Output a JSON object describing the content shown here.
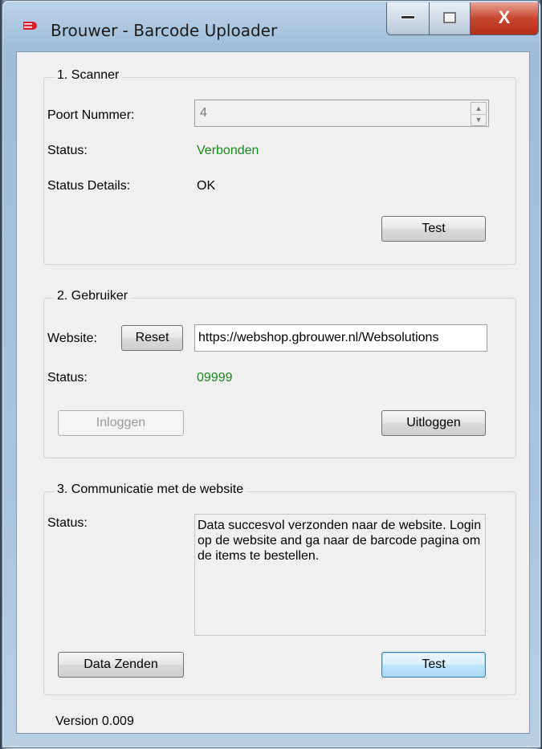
{
  "window": {
    "title": "Brouwer - Barcode Uploader",
    "app_icon": "brouwer-logo-icon"
  },
  "controls": {
    "minimize": "▁",
    "maximize": "▢",
    "close": "X"
  },
  "scanner": {
    "group_title": "1. Scanner",
    "port_label": "Poort Nummer:",
    "port_value": "4",
    "status_label": "Status:",
    "status_value": "Verbonden",
    "details_label": "Status Details:",
    "details_value": "OK",
    "test_button": "Test"
  },
  "user": {
    "group_title": "2. Gebruiker",
    "website_label": "Website:",
    "reset_button": "Reset",
    "website_value": "https://webshop.gbrouwer.nl/Websolutions",
    "status_label": "Status:",
    "status_value": "09999",
    "login_button": "Inloggen",
    "logout_button": "Uitloggen"
  },
  "communication": {
    "group_title": "3. Communicatie met de website",
    "status_label": "Status:",
    "status_message": "Data succesvol verzonden naar de website. Login op de website and ga naar de barcode pagina om de items te bestellen.",
    "send_button": "Data Zenden",
    "test_button": "Test"
  },
  "footer": {
    "version": "Version 0.009"
  },
  "colors": {
    "status_ok": "#1a8a1a",
    "close_button": "#c8462f"
  }
}
